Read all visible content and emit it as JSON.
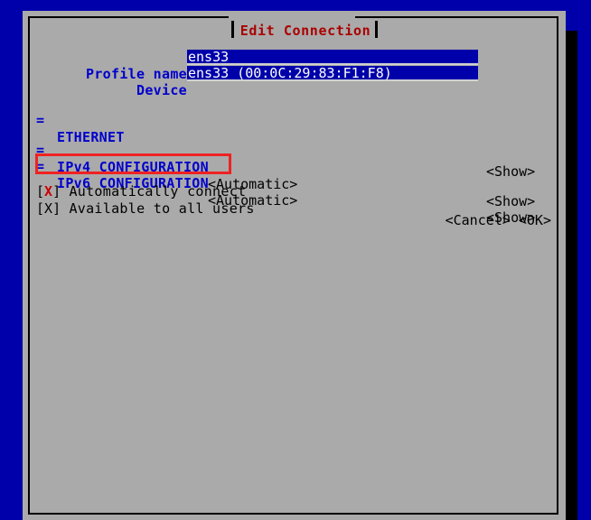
{
  "screen": {
    "background_color": "#0000aa"
  },
  "dialog": {
    "title": "Edit Connection",
    "title_color": "#aa0000",
    "panel_color": "#aaaaaa",
    "fields": [
      {
        "label": "Profile name",
        "value": "ens33",
        "value_padded": "ens33__________________________________",
        "placeholder": ""
      },
      {
        "label": "Device",
        "value": "ens33 (00:0C:29:83:F1:F8)",
        "value_padded": "ens33 (00:0C:29:83:F1:F8)______________",
        "placeholder": ""
      }
    ],
    "sections": [
      {
        "bullet": "=",
        "name": "ETHERNET",
        "value": "",
        "action": "<Show>"
      },
      {
        "bullet": "=",
        "name": "IPv4 CONFIGURATION",
        "value": "<Automatic>",
        "action": "<Show>"
      },
      {
        "bullet": "=",
        "name": "IPv6 CONFIGURATION",
        "value": "<Automatic>",
        "action": "<Show>"
      }
    ],
    "checkboxes": [
      {
        "open": "[",
        "mark": "X",
        "close": "]",
        "label": "Automatically connect",
        "checked": true,
        "focused": true,
        "mark_color": "#cc0000"
      },
      {
        "open": "[",
        "mark": "X",
        "close": "]",
        "label": "Available to all users",
        "checked": true,
        "focused": false,
        "mark_color": "#000000"
      }
    ],
    "buttons": {
      "cancel": "<Cancel>",
      "ok": "<OK>"
    }
  },
  "annotation": {
    "target": "Automatically connect",
    "color": "#ee2222"
  }
}
